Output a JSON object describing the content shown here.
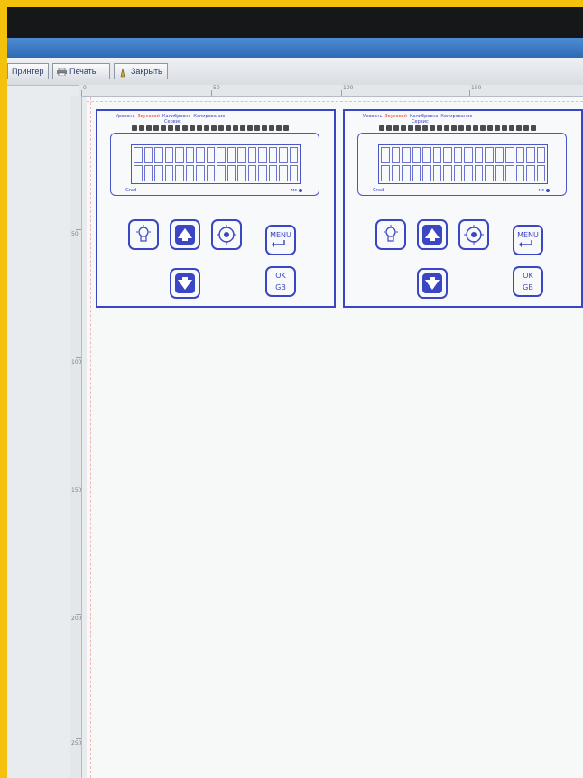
{
  "window": {
    "toolbar": {
      "buttons": [
        {
          "label": "Принтер",
          "icon": "printer-setup-icon"
        },
        {
          "label": "Печать",
          "icon": "printer-icon"
        },
        {
          "label": "Закрыть",
          "icon": "close-doc-icon"
        }
      ]
    },
    "ruler": {
      "top": [
        "0",
        "50",
        "100",
        "150"
      ],
      "left": [
        "50",
        "100",
        "150",
        "200",
        "250"
      ]
    }
  },
  "panels": [
    {
      "tabs": [
        "Уровень",
        "Звуковой",
        "Калибровка",
        "Копирование"
      ],
      "subtab": "Сервис",
      "lcd_left_label": "Grad",
      "lcd_right_label": "мс",
      "keys": {
        "menu_label": "MENU",
        "ok_label": "OK",
        "ok_sub": "GB"
      }
    },
    {
      "tabs": [
        "Уровень",
        "Звуковой",
        "Калибровка",
        "Копирование"
      ],
      "subtab": "Сервис",
      "lcd_left_label": "Grad",
      "lcd_right_label": "мс",
      "keys": {
        "menu_label": "MENU",
        "ok_label": "OK",
        "ok_sub": "GB"
      }
    }
  ],
  "colors": {
    "frame": "#f4c20d",
    "accent": "#3b46c4",
    "tab_highlight": "#e0433a"
  }
}
